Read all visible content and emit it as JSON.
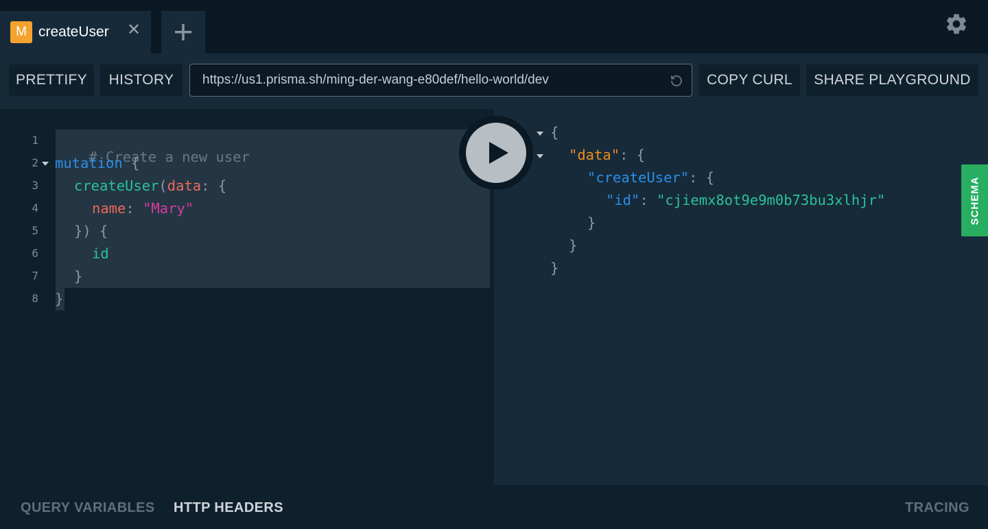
{
  "tabs": [
    {
      "badge": "M",
      "title": "createUser",
      "close_glyph": "✕",
      "icon": "mutation-badge-icon"
    }
  ],
  "tab_add_icon": "plus-icon",
  "settings_icon": "gear-icon",
  "toolbar": {
    "prettify_label": "PRETTIFY",
    "history_label": "HISTORY",
    "endpoint_url": "https://us1.prisma.sh/ming-der-wang-e80def/hello-world/dev",
    "reload_icon": "reload-icon",
    "copy_curl_label": "COPY CURL",
    "share_label": "SHARE PLAYGROUND"
  },
  "editor": {
    "line_numbers": [
      "1",
      "2",
      "3",
      "4",
      "5",
      "6",
      "7",
      "8"
    ],
    "lines": {
      "l1_comment": "# Create a new user",
      "l2_keyword": "mutation",
      "l2_brace": " {",
      "l3_field": "createUser",
      "l3_paren": "(",
      "l3_arg": "data",
      "l3_rest": ": {",
      "l4_arg": "name",
      "l4_colon": ": ",
      "l4_str": "\"Mary\"",
      "l5_punc": "}) {",
      "l6_field": "id",
      "l7_punc": "}",
      "l8_punc": "}"
    }
  },
  "result": {
    "open_brace": "{",
    "data_key": "\"data\"",
    "colon_brace": ": {",
    "create_key": "\"createUser\"",
    "id_key": "\"id\"",
    "colon": ": ",
    "id_value": "\"cjiemx8ot9e9m0b73bu3xlhjr\"",
    "close_brace": "}"
  },
  "schema_label": "SCHEMA",
  "bottom": {
    "query_variables": "QUERY VARIABLES",
    "http_headers": "HTTP HEADERS",
    "tracing": "TRACING"
  },
  "colors": {
    "accent_green": "#27ae60",
    "mutation_badge": "#f4a32f"
  }
}
